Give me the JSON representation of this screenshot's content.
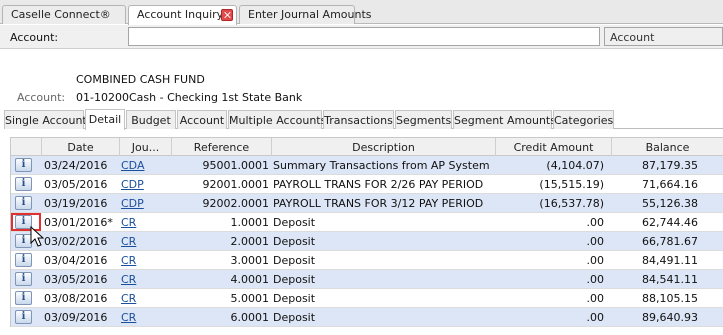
{
  "app_tabs": [
    {
      "label": "Caselle Connect®"
    },
    {
      "label": "Account Inquiry"
    },
    {
      "label": "Enter Journal Amounts"
    }
  ],
  "account_bar": {
    "label": "Account:",
    "value": "",
    "mode": "Account"
  },
  "account_info": {
    "fund": "COMBINED CASH FUND",
    "label": "Account:",
    "number": "01-10200",
    "name": "Cash - Checking 1st State Bank"
  },
  "sub_tabs": [
    {
      "label": "Single Account"
    },
    {
      "label": "Detail"
    },
    {
      "label": "Budget"
    },
    {
      "label": "Account"
    },
    {
      "label": "Multiple Accounts"
    },
    {
      "label": "Transactions"
    },
    {
      "label": "Segments"
    },
    {
      "label": "Segment Amounts"
    },
    {
      "label": "Categories"
    }
  ],
  "grid": {
    "headers": [
      "Date",
      "Jou...",
      "Reference",
      "Description",
      "Credit Amount",
      "Balance"
    ],
    "info_icon_glyph": "i",
    "rows": [
      {
        "date": "03/24/2016",
        "journal": "CDA",
        "reference": "95001.0001",
        "description": "Summary Transactions from AP System",
        "credit": "(4,104.07)",
        "balance": "87,179.35"
      },
      {
        "date": "03/05/2016",
        "journal": "CDP",
        "reference": "92001.0001",
        "description": "PAYROLL TRANS FOR 2/26 PAY PERIOD",
        "credit": "(15,515.19)",
        "balance": "71,664.16"
      },
      {
        "date": "03/19/2016",
        "journal": "CDP",
        "reference": "92002.0001",
        "description": "PAYROLL TRANS FOR 3/12 PAY PERIOD",
        "credit": "(16,537.78)",
        "balance": "55,126.38"
      },
      {
        "date": "03/01/2016*",
        "journal": "CR",
        "reference": "1.0001",
        "description": "Deposit",
        "credit": ".00",
        "balance": "62,744.46"
      },
      {
        "date": "03/02/2016",
        "journal": "CR",
        "reference": "2.0001",
        "description": "Deposit",
        "credit": ".00",
        "balance": "66,781.67"
      },
      {
        "date": "03/04/2016",
        "journal": "CR",
        "reference": "3.0001",
        "description": "Deposit",
        "credit": ".00",
        "balance": "84,491.11"
      },
      {
        "date": "03/05/2016",
        "journal": "CR",
        "reference": "4.0001",
        "description": "Deposit",
        "credit": ".00",
        "balance": "84,541.11"
      },
      {
        "date": "03/08/2016",
        "journal": "CR",
        "reference": "5.0001",
        "description": "Deposit",
        "credit": ".00",
        "balance": "88,105.15"
      },
      {
        "date": "03/09/2016",
        "journal": "CR",
        "reference": "6.0001",
        "description": "Deposit",
        "credit": ".00",
        "balance": "89,640.93"
      }
    ]
  },
  "colors": {
    "alt_row": "#dde6f6",
    "link": "#1a4f9c",
    "focus_outline": "#e03030",
    "close_button": "#e04a4a"
  }
}
